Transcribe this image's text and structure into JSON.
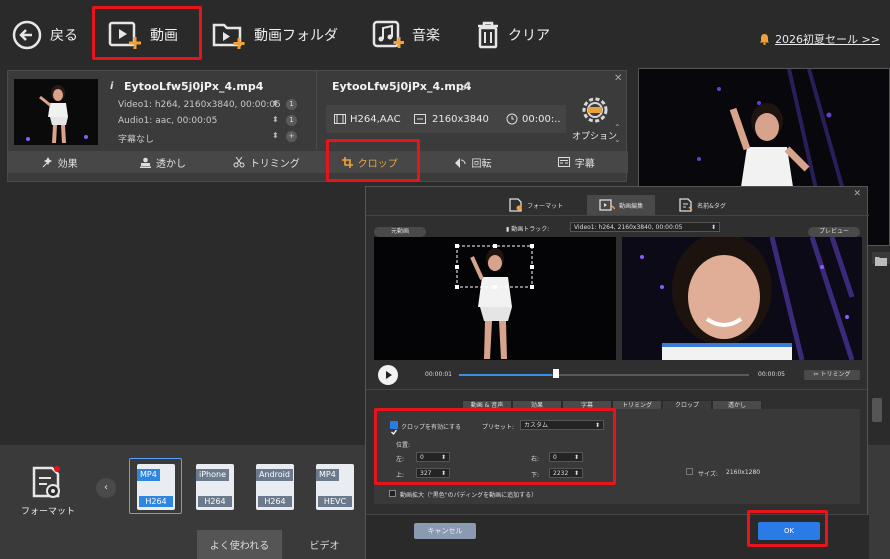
{
  "toolbar": {
    "back_label": "戻る",
    "video_label": "動画",
    "folder_label": "動画フォルダ",
    "music_label": "音楽",
    "clear_label": "クリア",
    "promo_label": "2026初夏セール >>"
  },
  "file": {
    "source_name": "EytooLfw5j0jPx_4.mp4",
    "video_info": "Video1: h264, 2160x3840, 00:00:05",
    "audio_info": "Audio1: aac, 00:00:05",
    "subtitle_info": "字幕なし",
    "track_count": "1",
    "output_name": "EytooLfw5j0jPx_4.mp4",
    "codec": "H264,AAC",
    "resolution": "2160x3840",
    "duration": "00:00:..",
    "options_label": "オプション"
  },
  "edit_tools": [
    {
      "label": "効果",
      "icon": "effect-icon"
    },
    {
      "label": "透かし",
      "icon": "watermark-icon"
    },
    {
      "label": "トリミング",
      "icon": "scissors-icon"
    },
    {
      "label": "クロップ",
      "icon": "crop-icon"
    },
    {
      "label": "回転",
      "icon": "rotate-icon"
    },
    {
      "label": "字幕",
      "icon": "subtitle-icon"
    }
  ],
  "dialog": {
    "tabs": [
      "フォーマット",
      "動画編集",
      "名前&タグ"
    ],
    "original_label": "元動画",
    "preview_label": "プレビュー",
    "track_label": "動画トラック:",
    "track_value": "Video1: h264, 2160x3840, 00:00:05",
    "time_start": "00:00:01",
    "time_end": "00:00:05",
    "trim_label": "トリミング",
    "sub_tabs": [
      "動画 & 音声",
      "効果",
      "字幕",
      "トリミング",
      "クロップ",
      "透かし"
    ],
    "crop_enable_label": "クロップを有効にする",
    "preset_label": "プリセット:",
    "preset_value": "カスタム",
    "position_label": "位置:",
    "left_label": "左:",
    "left_value": "0",
    "right_label": "右:",
    "right_value": "0",
    "top_label": "上:",
    "top_value": "327",
    "bottom_label": "下:",
    "bottom_value": "2232",
    "size_label": "サイズ:",
    "size_value": "2160x1280",
    "padding_label": "動画拡大（\"黒色\"のパディングを動画に追加する）",
    "cancel_label": "キャンセル",
    "ok_label": "OK"
  },
  "output": {
    "format_label": "フォーマット",
    "presets": [
      {
        "top": "MP4",
        "bottom": "H264"
      },
      {
        "top": "iPhone",
        "bottom": "H264"
      },
      {
        "top": "Android",
        "bottom": "H264"
      },
      {
        "top": "MP4",
        "bottom": "HEVC"
      }
    ],
    "tabs": [
      "よく使われる",
      "ビデオ"
    ]
  },
  "colors": {
    "highlight": "#e8141b",
    "accent_orange": "#f0a23a",
    "ok_blue": "#2b7be6"
  }
}
